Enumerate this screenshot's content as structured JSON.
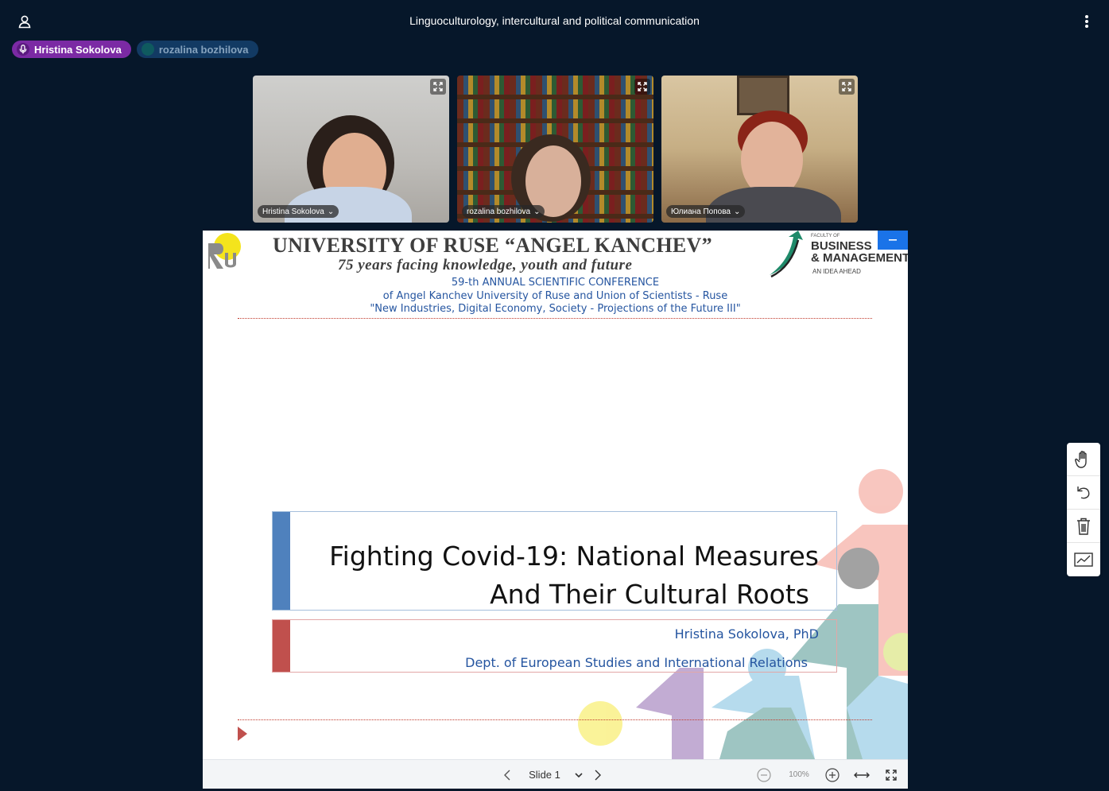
{
  "header": {
    "meeting_title": "Linguoculturology, intercultural and political communication",
    "user_icon": "user-icon",
    "more_icon": "vertical-dots-icon"
  },
  "talkers": [
    {
      "name": "Hristina Sokolova",
      "state": "talking"
    },
    {
      "name": "rozalina bozhilova",
      "state": "idle"
    }
  ],
  "videos": [
    {
      "name": "Hristina Sokolova"
    },
    {
      "name": "rozalina bozhilova"
    },
    {
      "name": "Юлиана Попова"
    }
  ],
  "slide": {
    "university": "UNIVERSITY OF RUSE “ANGEL KANCHEV”",
    "motto": "75  years  facing  knowledge, youth  and  future",
    "conference_line1": "59-th ANNUAL SCIENTIFIC CONFERENCE",
    "conference_line2": "of Angel Kanchev University of Ruse and Union of Scientists - Ruse",
    "conference_line3": "\"New Industries, Digital Economy, Society - Projections of the Future III\"",
    "faculty_small": "FACULTY OF",
    "faculty_line1": "BUSINESS",
    "faculty_line2": "& MANAGEMENT",
    "faculty_tagline": "AN IDEA AHEAD",
    "title_line1": "Fighting Covid-19: National Measures",
    "title_line2": "And Their Cultural Roots",
    "author": "Hristina Sokolova, PhD",
    "department": "Dept. of European Studies and International Relations"
  },
  "toolbar": {
    "slide_label": "Slide 1",
    "zoom": "100%"
  },
  "colors": {
    "background": "#06172a",
    "talker_active": "#7b2aa4",
    "talker_inactive": "#123a63",
    "accent_blue": "#1a73e8",
    "slide_blue": "#4f81bd",
    "slide_red": "#c0504d"
  }
}
